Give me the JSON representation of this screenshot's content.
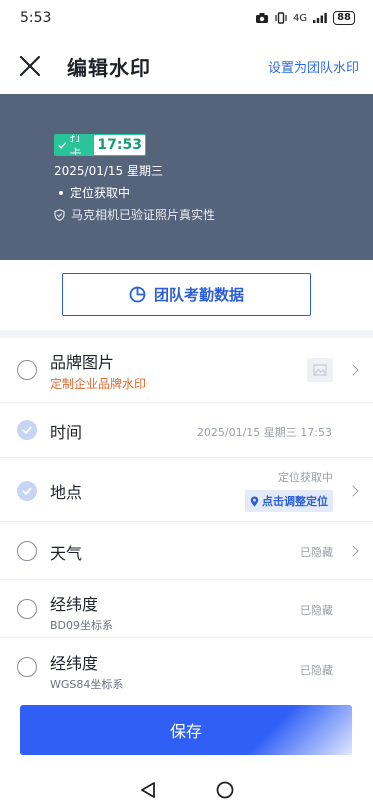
{
  "status": {
    "time": "5:53",
    "signal": "4G",
    "battery": "88"
  },
  "nav": {
    "title": "编辑水印",
    "action": "设置为团队水印"
  },
  "watermark": {
    "tag": "打卡",
    "time": "17:53",
    "date": "2025/01/15 星期三",
    "location": "定位获取中",
    "verify": "马克相机已验证照片真实性"
  },
  "team_button": {
    "label": "团队考勤数据"
  },
  "rows": [
    {
      "title": "品牌图片",
      "sub": "定制企业品牌水印"
    },
    {
      "title": "时间",
      "right": "2025/01/15 星期三 17:53"
    },
    {
      "title": "地点",
      "right": "定位获取中",
      "chip": "点击调整定位"
    },
    {
      "title": "天气",
      "right": "已隐藏"
    },
    {
      "title": "经纬度",
      "sub": "BD09坐标系",
      "right": "已隐藏"
    },
    {
      "title": "经纬度",
      "sub": "WGS84坐标系",
      "right": "已隐藏"
    }
  ],
  "save": {
    "label": "保存"
  },
  "colors": {
    "accent": "#2f5ff5",
    "brand_green": "#2bc39a",
    "preview_bg": "#56647b",
    "orange": "#e2682f"
  }
}
